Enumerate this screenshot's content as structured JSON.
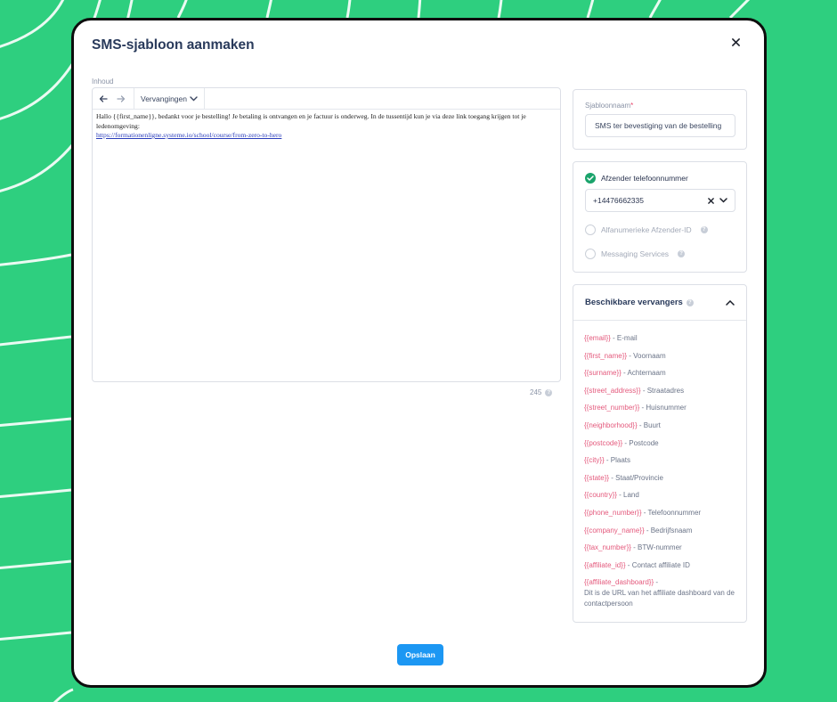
{
  "modal": {
    "title": "SMS-sjabloon aanmaken",
    "close_icon": "close-icon"
  },
  "editor": {
    "label": "Inhoud",
    "toolbar": {
      "undo_icon": "arrow-left-icon",
      "redo_icon": "arrow-right-icon",
      "replacements_label": "Vervangingen"
    },
    "content_text": "Hallo {{first_name}}, bedankt voor je bestelling! Je betaling is ontvangen en je factuur is onderweg. In de tussentijd kun je via deze link toegang krijgen tot je ledenomgeving:",
    "content_link": "https://formationenligne.systeme.io/school/course/from-zero-to-hero",
    "char_count": "245"
  },
  "template_name": {
    "label": "Sjabloonnaam",
    "required_mark": "*",
    "value": "SMS ter bevestiging van de bestelling"
  },
  "sender": {
    "options": [
      {
        "label": "Afzender telefoonnummer",
        "selected": true
      },
      {
        "label": "Alfanumerieke Afzender-ID",
        "selected": false
      },
      {
        "label": "Messaging Services",
        "selected": false
      }
    ],
    "phone_value": "+14476662335"
  },
  "replacements": {
    "title": "Beschikbare vervangers",
    "items": [
      {
        "token": "{{email}}",
        "desc": "E-mail"
      },
      {
        "token": "{{first_name}}",
        "desc": "Voornaam"
      },
      {
        "token": "{{surname}}",
        "desc": "Achternaam"
      },
      {
        "token": "{{street_address}}",
        "desc": "Straatadres"
      },
      {
        "token": "{{street_number}}",
        "desc": "Huisnummer"
      },
      {
        "token": "{{neighborhood}}",
        "desc": "Buurt"
      },
      {
        "token": "{{postcode}}",
        "desc": "Postcode"
      },
      {
        "token": "{{city}}",
        "desc": "Plaats"
      },
      {
        "token": "{{state}}",
        "desc": "Staat/Provincie"
      },
      {
        "token": "{{country}}",
        "desc": "Land"
      },
      {
        "token": "{{phone_number}}",
        "desc": "Telefoonnummer"
      },
      {
        "token": "{{company_name}}",
        "desc": "Bedrijfsnaam"
      },
      {
        "token": "{{tax_number}}",
        "desc": "BTW-nummer"
      },
      {
        "token": "{{affiliate_id}}",
        "desc": "Contact affiliate ID"
      },
      {
        "token": "{{affiliate_dashboard}}",
        "desc": ""
      }
    ],
    "last_item_description": "Dit is de URL van het affiliate dashboard van de contactpersoon"
  },
  "save_label": "Opslaan",
  "colors": {
    "background": "#2ecf7f",
    "primary": "#1c97f3",
    "token": "#e45a7d",
    "selected_radio": "#1aa36b",
    "title": "#293a5b"
  }
}
